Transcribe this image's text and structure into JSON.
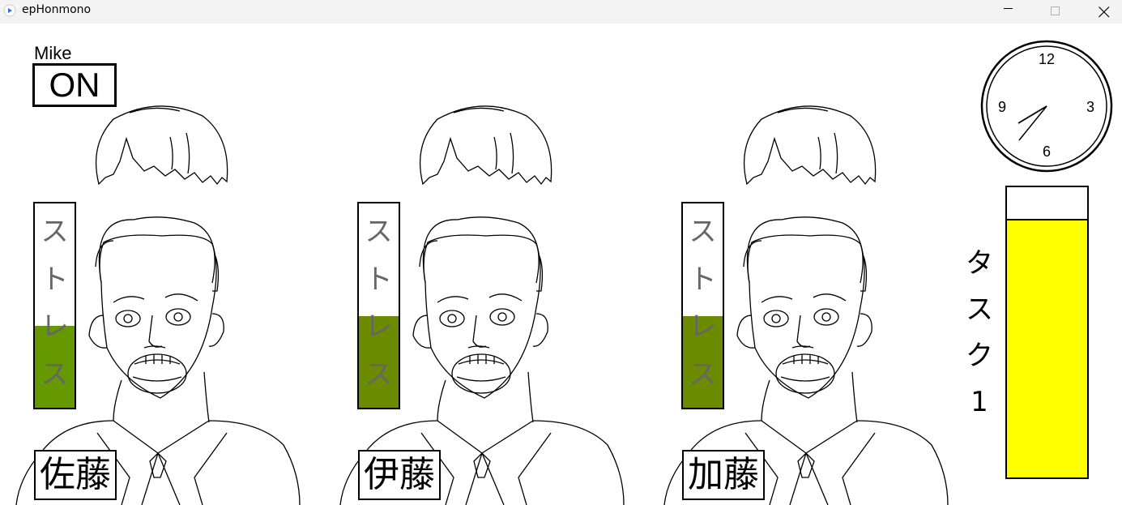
{
  "window": {
    "title": "epHonmono",
    "controls": {
      "minimize": "minimize-icon",
      "maximize": "maximize-icon",
      "close": "close-icon"
    }
  },
  "mike": {
    "label": "Mike",
    "state": "ON"
  },
  "stress_label_chars": [
    "ス",
    "ト",
    "レ",
    "ス"
  ],
  "people": [
    {
      "name": "佐藤",
      "stress_level": 0.4,
      "stress_color": "#669900"
    },
    {
      "name": "伊藤",
      "stress_level": 0.45,
      "stress_color": "#6b8c00"
    },
    {
      "name": "加藤",
      "stress_level": 0.45,
      "stress_color": "#6b8c00"
    }
  ],
  "clock": {
    "numbers": {
      "twelve": "12",
      "three": "3",
      "six": "6",
      "nine": "9"
    },
    "time": "7:36"
  },
  "task": {
    "label_chars": [
      "タ",
      "ス",
      "ク",
      "1"
    ],
    "progress": 0.89,
    "fill_color": "#ffff00"
  }
}
